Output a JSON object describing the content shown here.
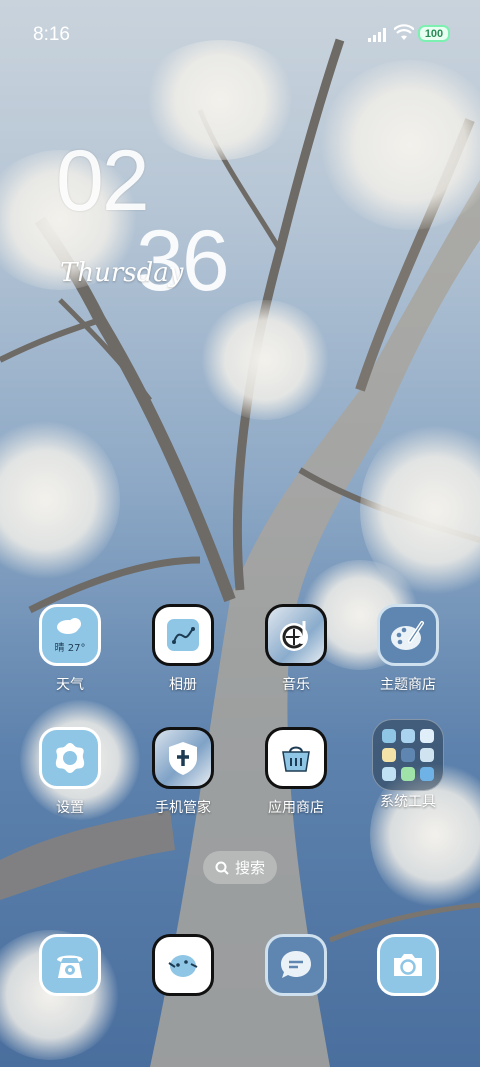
{
  "status_bar": {
    "time": "8:16",
    "battery": "100"
  },
  "clock": {
    "hours": "02",
    "minutes": "36",
    "day": "Thursday"
  },
  "apps": [
    {
      "label": "天气",
      "icon": "weather-icon",
      "sub": "晴 27°"
    },
    {
      "label": "相册",
      "icon": "gallery-icon"
    },
    {
      "label": "音乐",
      "icon": "music-icon"
    },
    {
      "label": "主题商店",
      "icon": "theme-store-icon"
    },
    {
      "label": "设置",
      "icon": "settings-icon"
    },
    {
      "label": "手机管家",
      "icon": "security-icon"
    },
    {
      "label": "应用商店",
      "icon": "app-store-icon"
    },
    {
      "label": "系统工具",
      "icon": "system-tools-folder-icon"
    }
  ],
  "search": {
    "label": "搜索"
  },
  "dock": [
    {
      "icon": "phone-icon"
    },
    {
      "icon": "browser-icon"
    },
    {
      "icon": "messages-icon"
    },
    {
      "icon": "camera-icon"
    }
  ],
  "colors": {
    "icon_blue": "#8fc6e6",
    "icon_dark": "#5f86b1",
    "battery_green": "#7cf0b0"
  }
}
